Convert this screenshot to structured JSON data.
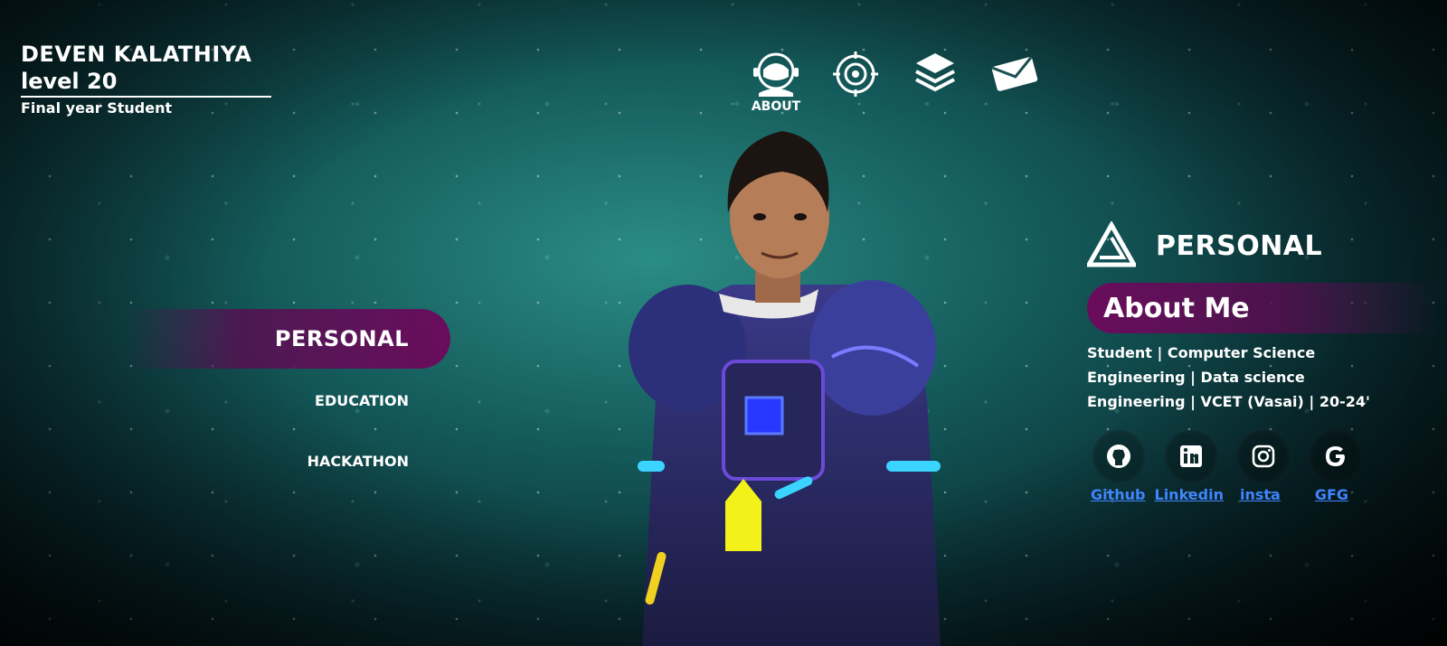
{
  "profile": {
    "name": "DEVEN KALATHIYA",
    "level": "level 20",
    "role": "Final year Student"
  },
  "topnav": {
    "items": [
      {
        "icon": "astronaut-helmet-icon",
        "label": "ABOUT"
      },
      {
        "icon": "target-icon",
        "label": ""
      },
      {
        "icon": "layers-icon",
        "label": ""
      },
      {
        "icon": "envelope-icon",
        "label": ""
      }
    ]
  },
  "leftmenu": {
    "active": "PERSONAL",
    "items": [
      "EDUCATION",
      "HACKATHON"
    ]
  },
  "panel": {
    "heading": "PERSONAL",
    "about_title": "About Me",
    "description": "Student | Computer Science Engineering | Data science Engineering | VCET (Vasai) | 20-24'",
    "socials": [
      {
        "icon": "github-icon",
        "label": "Github"
      },
      {
        "icon": "linkedin-icon",
        "label": "Linkedin"
      },
      {
        "icon": "instagram-icon",
        "label": "insta"
      },
      {
        "icon": "google-icon",
        "label": "GFG"
      }
    ]
  },
  "colors": {
    "accent_purple": "#6a0c5c",
    "link_blue": "#3f86ff",
    "bg_teal": "#2b8c86"
  }
}
